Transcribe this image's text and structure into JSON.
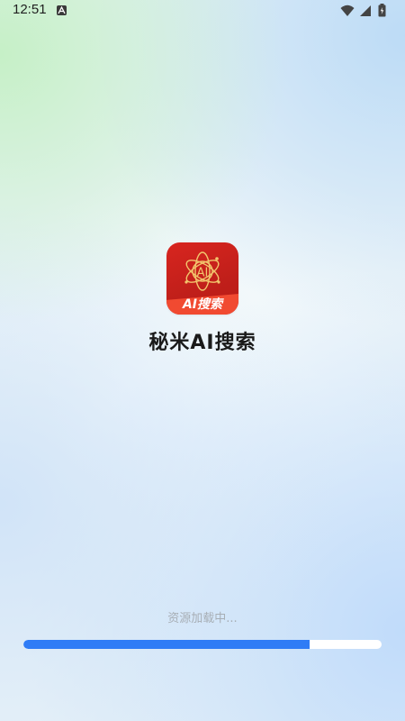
{
  "status_bar": {
    "time": "12:51",
    "icons": [
      "a-notification-icon",
      "wifi-icon",
      "cellular-signal-icon",
      "battery-icon"
    ]
  },
  "splash": {
    "logo_label": "AI搜索",
    "logo_emblem_text": "AI",
    "app_name": "秘米AI搜索",
    "loading_text": "资源加载中...",
    "progress": 0.8
  },
  "colors": {
    "logo_red": "#c8211c",
    "banner_red": "#f14a31",
    "logo_gold": "#f2c66d",
    "progress_blue": "#2f7cf6",
    "progress_track": "#ffffff"
  }
}
